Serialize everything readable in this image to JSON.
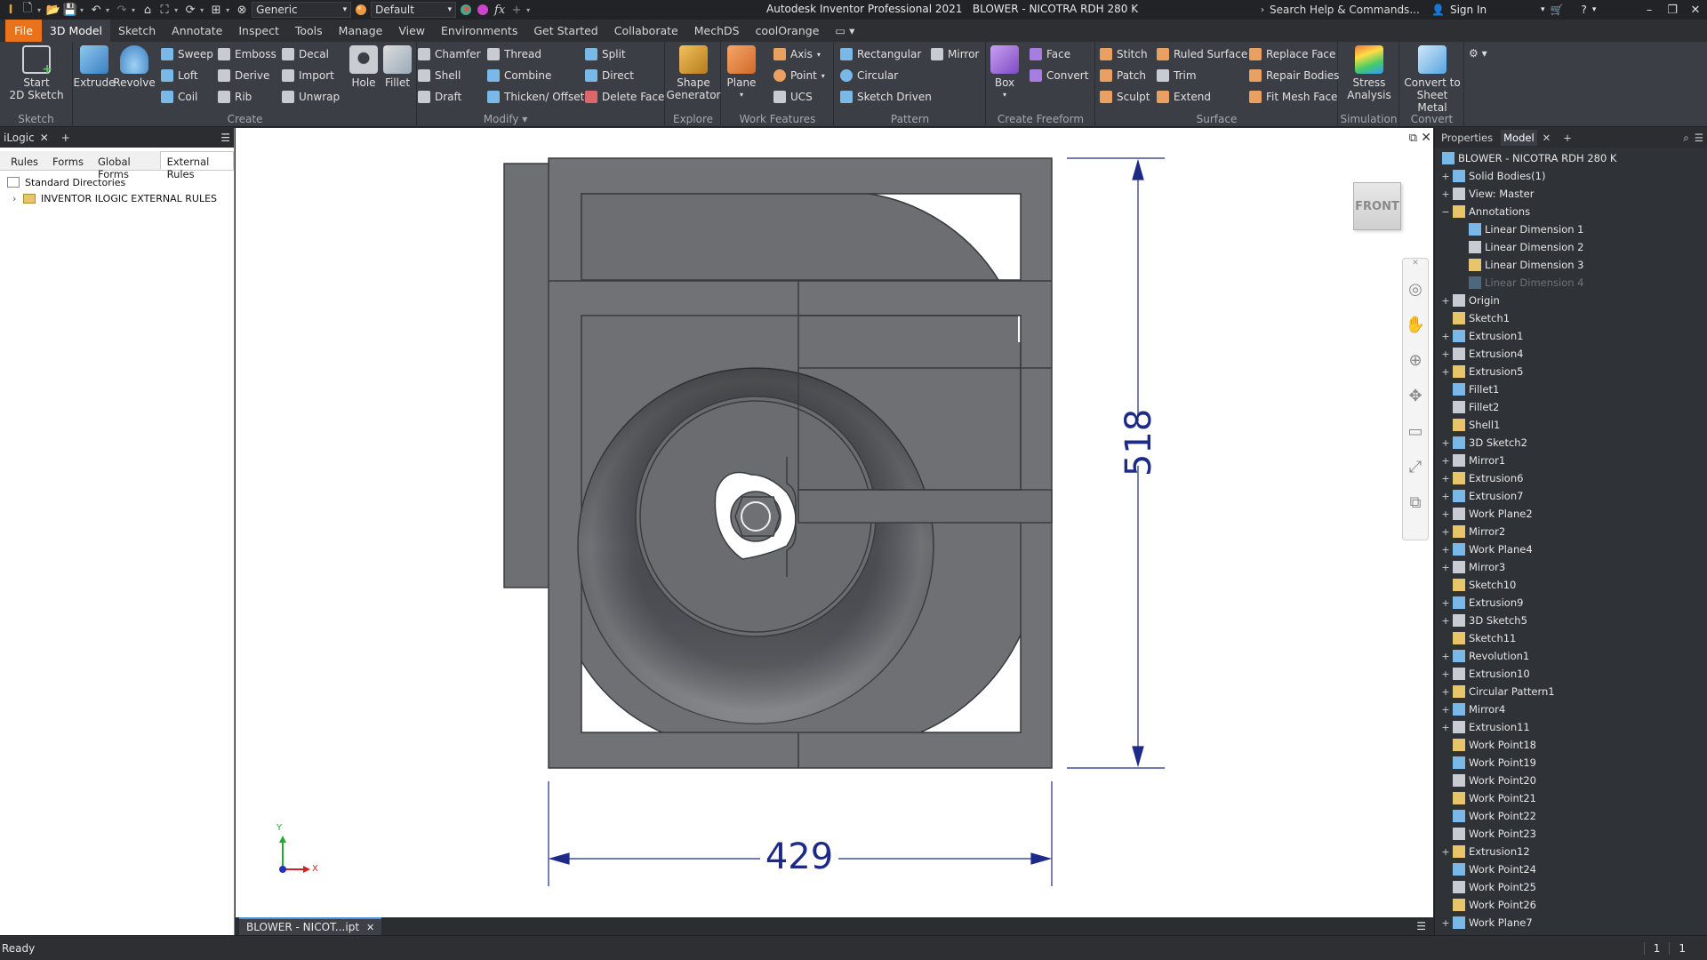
{
  "app": {
    "title": "Autodesk Inventor Professional 2021",
    "document_name": "BLOWER - NICOTRA RDH 280 K",
    "search_placeholder": "Search Help & Commands...",
    "sign_in": "Sign In"
  },
  "quick_access": {
    "appearance_combo": "Generic",
    "material_combo": "Default",
    "fx": "fx"
  },
  "menu_tabs": [
    {
      "label": "File"
    },
    {
      "label": "3D Model"
    },
    {
      "label": "Sketch"
    },
    {
      "label": "Annotate"
    },
    {
      "label": "Inspect"
    },
    {
      "label": "Tools"
    },
    {
      "label": "Manage"
    },
    {
      "label": "View"
    },
    {
      "label": "Environments"
    },
    {
      "label": "Get Started"
    },
    {
      "label": "Collaborate"
    },
    {
      "label": "MechDS"
    },
    {
      "label": "coolOrange"
    }
  ],
  "ribbon": {
    "panels": {
      "sketch": "Sketch",
      "create": "Create",
      "modify": "Modify",
      "explore": "Explore",
      "work_features": "Work Features",
      "pattern": "Pattern",
      "create_freeform": "Create Freeform",
      "surface": "Surface",
      "simulation": "Simulation",
      "convert": "Convert"
    },
    "buttons": {
      "start_sketch_1": "Start",
      "start_sketch_2": "2D Sketch",
      "extrude": "Extrude",
      "revolve": "Revolve",
      "sweep": "Sweep",
      "emboss": "Emboss",
      "decal": "Decal",
      "loft": "Loft",
      "derive": "Derive",
      "import": "Import",
      "coil": "Coil",
      "rib": "Rib",
      "unwrap": "Unwrap",
      "hole": "Hole",
      "fillet": "Fillet",
      "chamfer": "Chamfer",
      "thread": "Thread",
      "split": "Split",
      "shell": "Shell",
      "combine": "Combine",
      "direct": "Direct",
      "draft": "Draft",
      "thicken": "Thicken/ Offset",
      "delete_face": "Delete Face",
      "shape_gen_1": "Shape",
      "shape_gen_2": "Generator",
      "plane": "Plane",
      "axis": "Axis",
      "point": "Point",
      "ucs": "UCS",
      "rectangular": "Rectangular",
      "circular": "Circular",
      "sketch_driven": "Sketch Driven",
      "mirror": "Mirror",
      "box": "Box",
      "face": "Face",
      "convert_ff": "Convert",
      "stitch": "Stitch",
      "patch": "Patch",
      "sculpt": "Sculpt",
      "ruled_surface": "Ruled Surface",
      "trim": "Trim",
      "extend": "Extend",
      "replace_face": "Replace Face",
      "repair_bodies": "Repair Bodies",
      "fit_mesh_face": "Fit Mesh Face",
      "stress_1": "Stress",
      "stress_2": "Analysis",
      "convert_sm_1": "Convert to",
      "convert_sm_2": "Sheet Metal"
    }
  },
  "ilogic": {
    "title": "iLogic",
    "tabs": [
      "Rules",
      "Forms",
      "Global Forms",
      "External Rules"
    ],
    "tree": [
      "Standard Directories",
      "INVENTOR ILOGIC EXTERNAL RULES"
    ]
  },
  "viewport": {
    "viewcube_label": "FRONT",
    "dimensions": {
      "height": "518",
      "width": "429"
    },
    "triad": {
      "x": "X",
      "y": "Y"
    }
  },
  "document_tab": "BLOWER - NICOT...ipt",
  "browser": {
    "tabs": [
      "Properties",
      "Model"
    ],
    "root": "BLOWER - NICOTRA RDH 280 K",
    "items": [
      {
        "label": "Solid Bodies(1)",
        "level": 1,
        "exp": "+"
      },
      {
        "label": "View: Master",
        "level": 1,
        "exp": "+"
      },
      {
        "label": "Annotations",
        "level": 1,
        "exp": "−"
      },
      {
        "label": "Linear Dimension 1",
        "level": 2,
        "exp": ""
      },
      {
        "label": "Linear Dimension 2",
        "level": 2,
        "exp": ""
      },
      {
        "label": "Linear Dimension 3",
        "level": 2,
        "exp": ""
      },
      {
        "label": "Linear Dimension 4",
        "level": 2,
        "exp": "",
        "dim": true
      },
      {
        "label": "Origin",
        "level": 1,
        "exp": "+"
      },
      {
        "label": "Sketch1",
        "level": 1,
        "exp": ""
      },
      {
        "label": "Extrusion1",
        "level": 1,
        "exp": "+"
      },
      {
        "label": "Extrusion4",
        "level": 1,
        "exp": "+"
      },
      {
        "label": "Extrusion5",
        "level": 1,
        "exp": "+"
      },
      {
        "label": "Fillet1",
        "level": 1,
        "exp": ""
      },
      {
        "label": "Fillet2",
        "level": 1,
        "exp": ""
      },
      {
        "label": "Shell1",
        "level": 1,
        "exp": ""
      },
      {
        "label": "3D Sketch2",
        "level": 1,
        "exp": "+"
      },
      {
        "label": "Mirror1",
        "level": 1,
        "exp": "+"
      },
      {
        "label": "Extrusion6",
        "level": 1,
        "exp": "+"
      },
      {
        "label": "Extrusion7",
        "level": 1,
        "exp": "+"
      },
      {
        "label": "Work Plane2",
        "level": 1,
        "exp": "+"
      },
      {
        "label": "Mirror2",
        "level": 1,
        "exp": "+"
      },
      {
        "label": "Work Plane4",
        "level": 1,
        "exp": "+"
      },
      {
        "label": "Mirror3",
        "level": 1,
        "exp": "+"
      },
      {
        "label": "Sketch10",
        "level": 1,
        "exp": ""
      },
      {
        "label": "Extrusion9",
        "level": 1,
        "exp": "+"
      },
      {
        "label": "3D Sketch5",
        "level": 1,
        "exp": "+"
      },
      {
        "label": "Sketch11",
        "level": 1,
        "exp": ""
      },
      {
        "label": "Revolution1",
        "level": 1,
        "exp": "+"
      },
      {
        "label": "Extrusion10",
        "level": 1,
        "exp": "+"
      },
      {
        "label": "Circular Pattern1",
        "level": 1,
        "exp": "+"
      },
      {
        "label": "Mirror4",
        "level": 1,
        "exp": "+"
      },
      {
        "label": "Extrusion11",
        "level": 1,
        "exp": "+"
      },
      {
        "label": "Work Point18",
        "level": 1,
        "exp": ""
      },
      {
        "label": "Work Point19",
        "level": 1,
        "exp": ""
      },
      {
        "label": "Work Point20",
        "level": 1,
        "exp": ""
      },
      {
        "label": "Work Point21",
        "level": 1,
        "exp": ""
      },
      {
        "label": "Work Point22",
        "level": 1,
        "exp": ""
      },
      {
        "label": "Work Point23",
        "level": 1,
        "exp": ""
      },
      {
        "label": "Extrusion12",
        "level": 1,
        "exp": "+"
      },
      {
        "label": "Work Point24",
        "level": 1,
        "exp": ""
      },
      {
        "label": "Work Point25",
        "level": 1,
        "exp": ""
      },
      {
        "label": "Work Point26",
        "level": 1,
        "exp": ""
      },
      {
        "label": "Work Plane7",
        "level": 1,
        "exp": "+"
      }
    ]
  },
  "status": {
    "text": "Ready",
    "count1": "1",
    "count2": "1"
  }
}
